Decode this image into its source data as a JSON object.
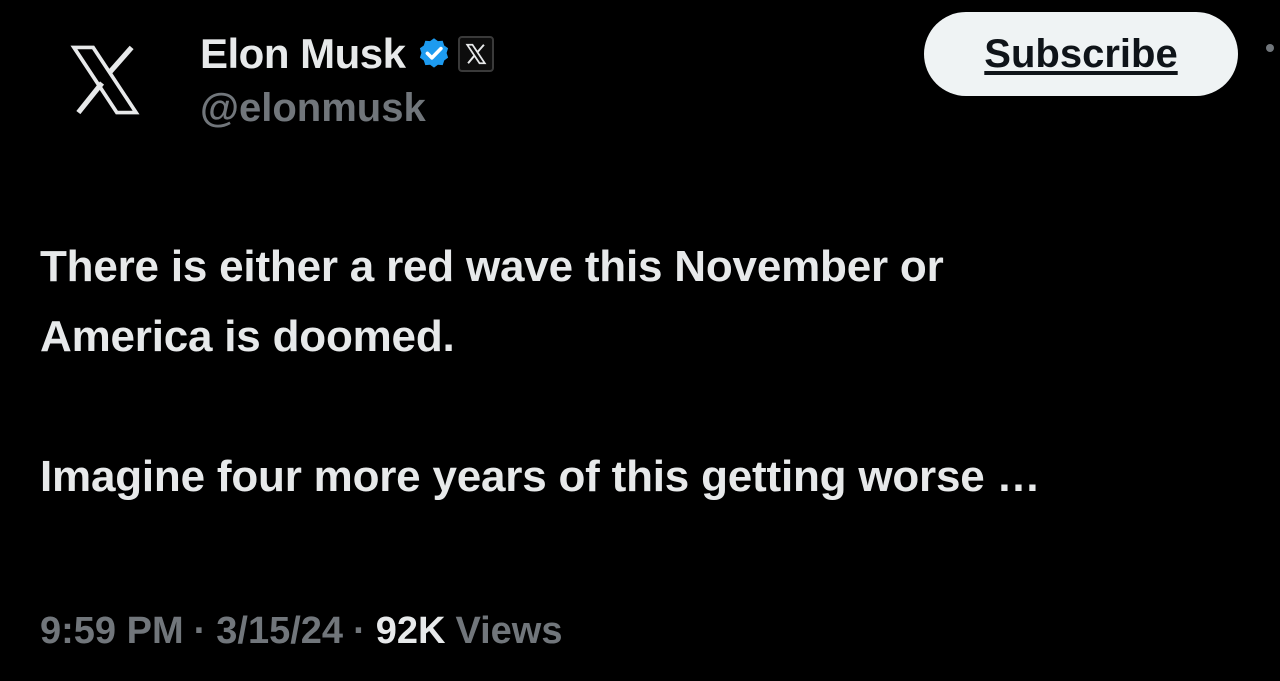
{
  "post": {
    "author": {
      "display_name": "Elon Musk",
      "handle": "@elonmusk",
      "avatar_icon": "x-logo-icon",
      "verified_icon": "verified-badge-icon",
      "verified_color": "#1d9bf0",
      "affiliate_icon": "x-affiliate-badge-icon"
    },
    "subscribe_label": "Subscribe",
    "text_lines": [
      "There is either a red wave this November or",
      "America is doomed.",
      "Imagine four more years of this getting worse …"
    ],
    "meta": {
      "time": "9:59 PM",
      "separator": "·",
      "date": "3/15/24",
      "views_count": "92K",
      "views_label": "Views"
    }
  },
  "colors": {
    "background": "#000000",
    "primary_text": "#e7e9ea",
    "secondary_text": "#71767b",
    "button_bg": "#eff3f4"
  }
}
